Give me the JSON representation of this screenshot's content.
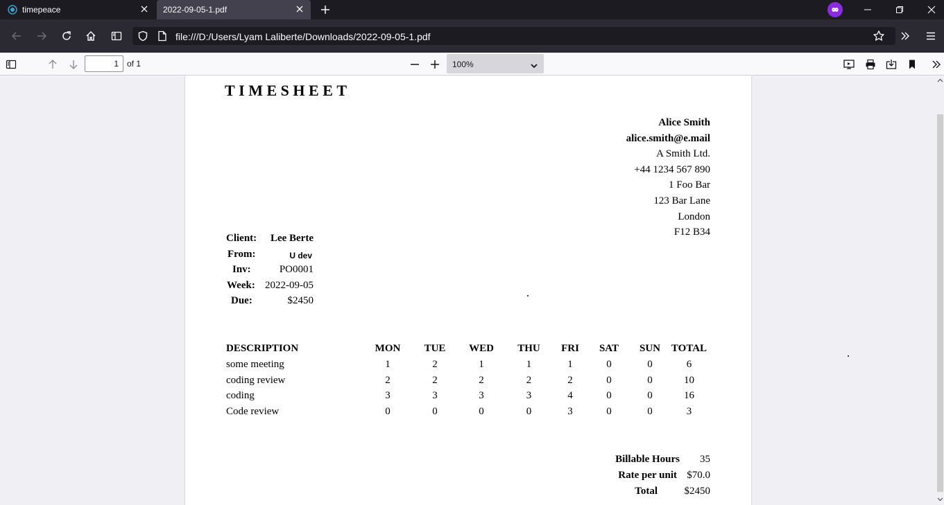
{
  "tabs": [
    {
      "label": "timepeace"
    },
    {
      "label": "2022-09-05-1.pdf"
    }
  ],
  "address_bar": {
    "url": "file:///D:/Users/Lyam Laliberte/Downloads/2022-09-05-1.pdf"
  },
  "pdf_toolbar": {
    "page_number": "1",
    "page_count_label": "of 1",
    "zoom": "100%"
  },
  "document": {
    "title": "TIMESHEET",
    "sender": {
      "name": "Alice Smith",
      "email": "alice.smith@e.mail",
      "company": "A Smith Ltd.",
      "phone": "+44 1234 567 890",
      "address1": "1 Foo Bar",
      "address2": "123 Bar Lane",
      "city": "London",
      "postcode": "F12 B34"
    },
    "meta": {
      "client_label": "Client:",
      "client": "Lee Berte",
      "from_label": "From:",
      "from": "U dev",
      "inv_label": "Inv:",
      "inv": "PO0001",
      "week_label": "Week:",
      "week": "2022-09-05",
      "due_label": "Due:",
      "due": "$2450"
    },
    "table": {
      "headers": [
        "DESCRIPTION",
        "MON",
        "TUE",
        "WED",
        "THU",
        "FRI",
        "SAT",
        "SUN",
        "TOTAL"
      ],
      "rows": [
        [
          "some meeting",
          "1",
          "2",
          "1",
          "1",
          "1",
          "0",
          "0",
          "6"
        ],
        [
          "coding review",
          "2",
          "2",
          "2",
          "2",
          "2",
          "0",
          "0",
          "10"
        ],
        [
          "coding",
          "3",
          "3",
          "3",
          "3",
          "4",
          "0",
          "0",
          "16"
        ],
        [
          "Code review",
          "0",
          "0",
          "0",
          "0",
          "3",
          "0",
          "0",
          "3"
        ]
      ]
    },
    "totals": {
      "billable_label": "Billable Hours",
      "billable": "35",
      "rate_label": "Rate per unit",
      "rate": "$70.0",
      "total_label": "Total",
      "total": "$2450"
    }
  },
  "colors": {
    "accent": "#8a2be2",
    "chrome": "#1c1b22",
    "navbar": "#2b2a33"
  }
}
